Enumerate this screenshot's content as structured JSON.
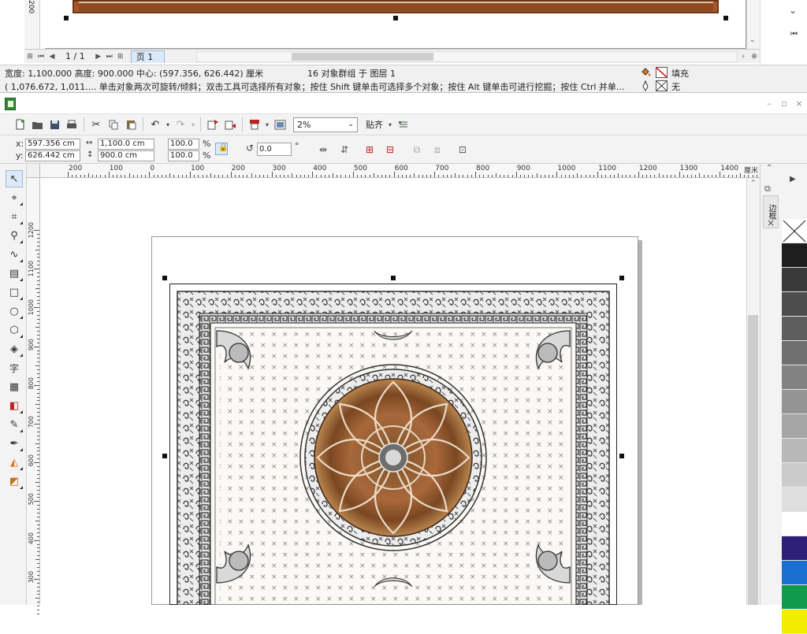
{
  "ghost": {
    "ruler_tick": "200",
    "pager": {
      "page_count": "1 / 1",
      "page_tab": "页 1"
    }
  },
  "status": {
    "dims": "宽度: 1,100.000  高度: 900.000  中心: (597.356, 626.442)  厘米",
    "group": "16 对象群组 于 图层 1",
    "hint": "( 1,076.672, 1,011....  单击对象两次可旋转/倾斜；双击工具可选择所有对象；按住 Shift 键单击可选择多个对象；按住 Alt 键单击可进行挖掘；按住 Ctrl 并单...",
    "fill_label": "填充",
    "outline_label": "无"
  },
  "toolbar": {
    "zoom": "2%",
    "snap": "贴齐"
  },
  "props": {
    "x_label": "x:",
    "x": "597.356 cm",
    "y_label": "y:",
    "y": "626.442 cm",
    "width": "1,100.0 cm",
    "height": "900.0 cm",
    "scale_w": "100.0",
    "scale_h": "100.0",
    "pct": "%",
    "rotation": "0.0",
    "degree": "°"
  },
  "toolbox": {
    "text_tool": "字"
  },
  "ruler": {
    "unit": "厘米",
    "h_ticks": [
      "200",
      "100",
      "0",
      "100",
      "200",
      "300",
      "400",
      "500",
      "600",
      "700",
      "800",
      "900",
      "1000",
      "1100",
      "1200",
      "1300",
      "1400"
    ],
    "v_ticks": [
      "1200",
      "1100",
      "1000",
      "900",
      "800",
      "700",
      "600",
      "500",
      "400",
      "300"
    ]
  },
  "docker": {
    "tab_label": "边框"
  },
  "colors": {
    "accent": "#dbe9f9",
    "border_wood": "#a5592a",
    "palette": [
      "none",
      "#1e1e1e",
      "#3a3a3a",
      "#4d4d4d",
      "#5e5e5e",
      "#707070",
      "#828282",
      "#949494",
      "#a6a6a6",
      "#b8b8b8",
      "#cbcbcb",
      "#dedede",
      "#ffffff",
      "#2d1f7a",
      "#1a6fd0",
      "#0e9b50",
      "#f2ec00"
    ]
  }
}
